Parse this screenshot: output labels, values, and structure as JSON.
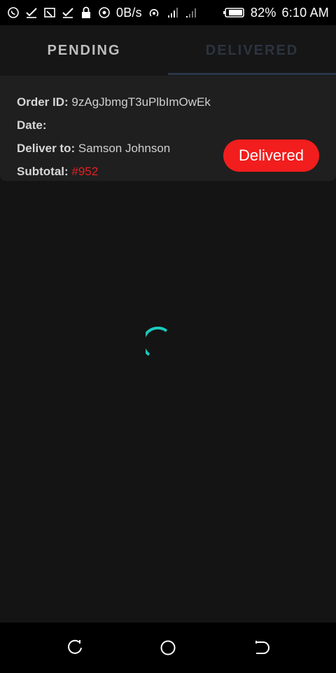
{
  "status_bar": {
    "network_speed": "0B/s",
    "battery": "82%",
    "time": "6:10 AM",
    "icons_left": [
      "whatsapp-icon",
      "check-icon",
      "cast-icon",
      "check-icon",
      "lock-icon",
      "target-icon"
    ],
    "icons_right": [
      "hotspot-icon",
      "signal-icon",
      "signal-icon",
      "battery-icon"
    ]
  },
  "tabs": [
    {
      "label": "PENDING",
      "active": false
    },
    {
      "label": "DELIVERED",
      "active": true
    }
  ],
  "order": {
    "id_label": "Order ID:",
    "id_value": "9zAgJbmgT3uPlbImOwEk",
    "date_label": "Date:",
    "date_value": "",
    "deliver_label": "Deliver to:",
    "deliver_value": "Samson Johnson",
    "subtotal_label": "Subtotal:",
    "subtotal_value": "#952",
    "status": "Delivered"
  },
  "colors": {
    "background": "#141414",
    "card": "#1f1f1f",
    "status_pill": "#f21d1d",
    "subtotal": "#e52020",
    "spinner": "#1cc9bd",
    "tab_active_text": "#2c3440",
    "tab_inactive_text": "#bdbdbd"
  },
  "nav": [
    "recent-apps-icon",
    "home-icon",
    "back-icon"
  ]
}
